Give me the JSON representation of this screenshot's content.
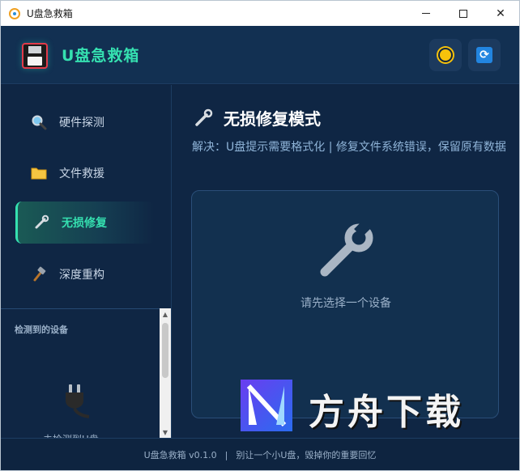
{
  "window": {
    "title": "U盘急救箱"
  },
  "header": {
    "brand": "U盘急救箱"
  },
  "sidebar": {
    "items": [
      {
        "label": "硬件探测",
        "icon": "magnifier-icon"
      },
      {
        "label": "文件救援",
        "icon": "folder-icon"
      },
      {
        "label": "无损修复",
        "icon": "wrench-icon",
        "active": true
      },
      {
        "label": "深度重构",
        "icon": "hammer-icon"
      }
    ],
    "devices_title": "检测到的设备",
    "devices_hint": "未检测到U盘"
  },
  "main": {
    "title": "无损修复模式",
    "description": "解决：U盘提示需要格式化 | 修复文件系统错误，保留原有数据",
    "empty_text": "请先选择一个设备"
  },
  "footer": {
    "version": "U盘急救箱 v0.1.0",
    "separator": "|",
    "slogan": "别让一个小U盘，毁掉你的重要回忆"
  },
  "watermark": {
    "text": "方舟下载"
  },
  "colors": {
    "accent": "#35e0b0",
    "background": "#0f2644",
    "panel": "#12304f"
  }
}
